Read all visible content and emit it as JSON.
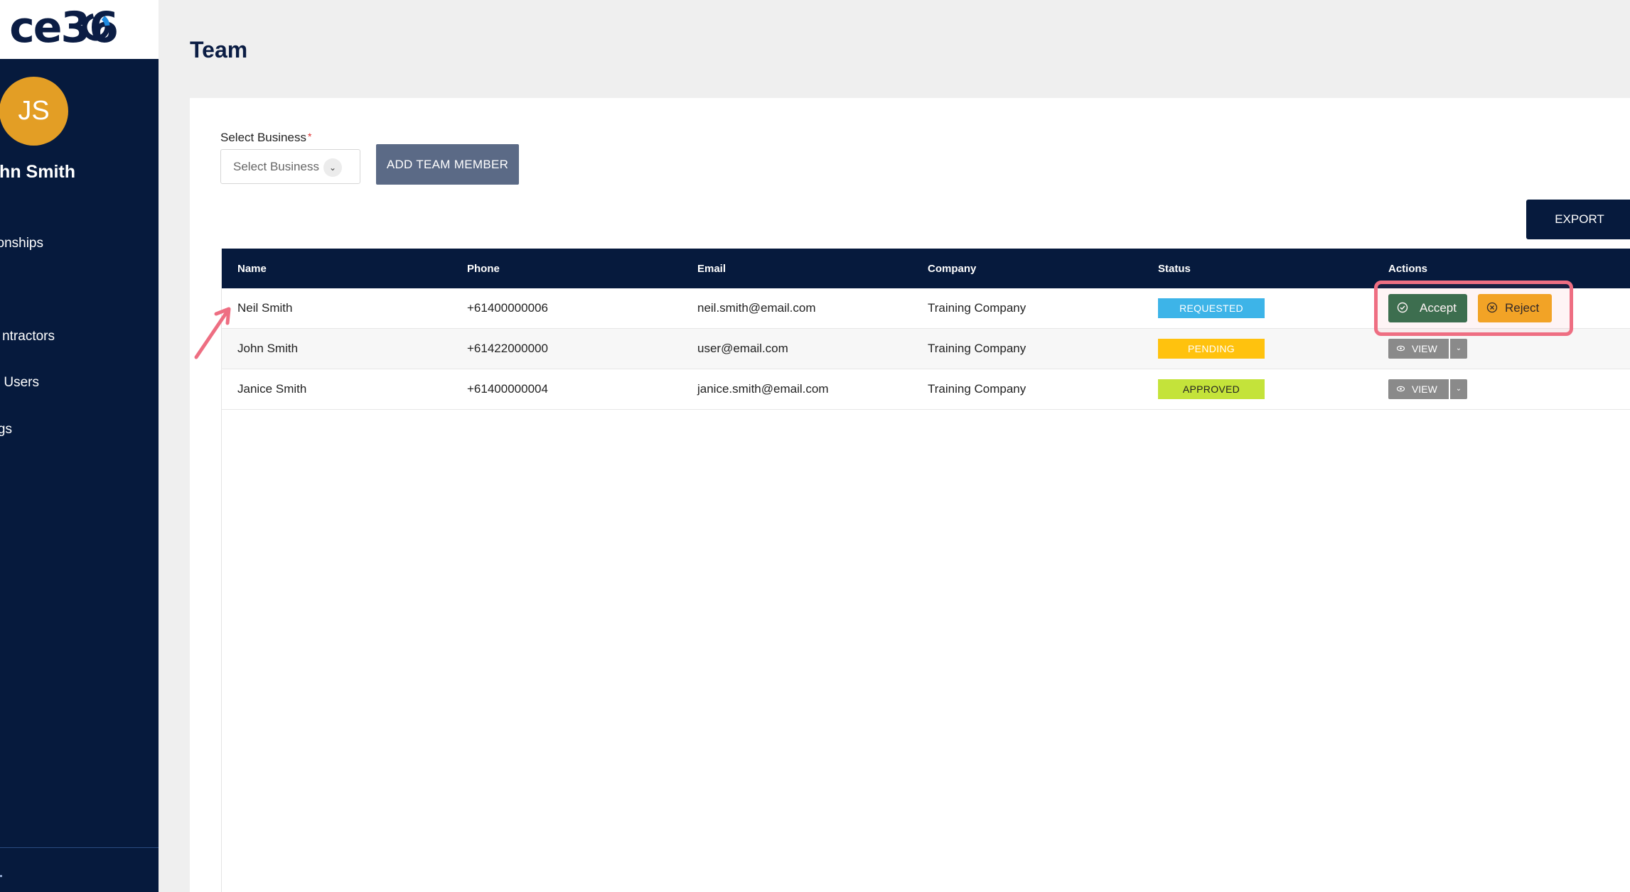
{
  "sidebar": {
    "logo_text": "ce36",
    "avatar_initials": "JS",
    "user_name": "ohn Smith",
    "items": [
      {
        "label": "onships"
      },
      {
        "label": "ntractors"
      },
      {
        "label": "n Users"
      },
      {
        "label": "gs"
      }
    ]
  },
  "header": {
    "title": "Team"
  },
  "filters": {
    "select_label": "Select Business",
    "required_mark": "*",
    "select_value": "Select Business",
    "add_button": "ADD TEAM MEMBER",
    "export_button": "EXPORT"
  },
  "table": {
    "headers": [
      "Name",
      "Phone",
      "Email",
      "Company",
      "Status",
      "Actions"
    ],
    "rows": [
      {
        "name": "Neil Smith",
        "phone": "+61400000006",
        "email": "neil.smith@email.com",
        "company": "Training Company",
        "status": "REQUESTED"
      },
      {
        "name": "John Smith",
        "phone": "+61422000000",
        "email": "user@email.com",
        "company": "Training Company",
        "status": "PENDING"
      },
      {
        "name": "Janice Smith",
        "phone": "+61400000004",
        "email": "janice.smith@email.com",
        "company": "Training Company",
        "status": "APPROVED"
      }
    ],
    "accept_label": "Accept",
    "reject_label": "Reject",
    "view_label": "VIEW"
  },
  "colors": {
    "sidebar": "#061a3d",
    "avatar": "#e39e25",
    "requested": "#3db4e8",
    "pending": "#ffc20e",
    "approved": "#c4e33a",
    "accept": "#2e6e4b",
    "reject": "#f2a81f",
    "highlight": "#ee6e82"
  }
}
